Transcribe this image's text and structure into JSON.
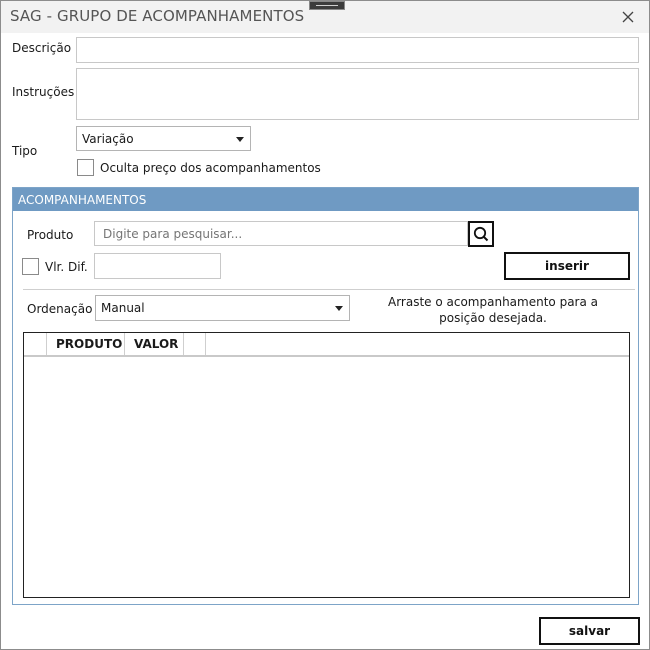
{
  "window": {
    "title": "SAG - GRUPO DE ACOMPANHAMENTOS",
    "close_icon": "close-icon"
  },
  "form": {
    "descricao_label": "Descrição",
    "descricao_value": "",
    "instrucoes_label": "Instruções",
    "instrucoes_value": "",
    "tipo_label": "Tipo",
    "tipo_selected": "Variação",
    "oculta_label": "Oculta preço dos acompanhamentos",
    "oculta_checked": false
  },
  "acompanhamentos": {
    "header": "ACOMPANHAMENTOS",
    "produto_label": "Produto",
    "produto_placeholder": "Digite para pesquisar...",
    "search_icon": "search-icon",
    "vlr_dif_label": "Vlr. Dif.",
    "vlr_dif_checked": false,
    "vlr_dif_value": "",
    "inserir_label": "inserir",
    "ordenacao_label": "Ordenação",
    "ordenacao_selected": "Manual",
    "hint": "Arraste o acompanhamento para a posição desejada.",
    "grid_columns": [
      "",
      "PRODUTO",
      "VALOR",
      ""
    ],
    "grid_rows": []
  },
  "footer": {
    "salvar_label": "salvar"
  },
  "colors": {
    "group_header": "#6f9ac3",
    "titlebar": "#f2f2f2"
  }
}
